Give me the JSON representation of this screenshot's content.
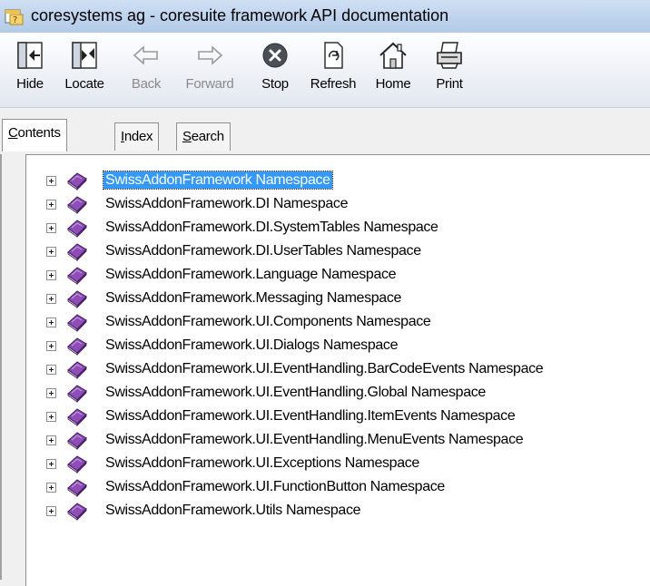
{
  "window": {
    "title": "coresystems ag - coresuite framework API documentation"
  },
  "toolbar": {
    "buttons": [
      {
        "label": "Hide",
        "icon": "hide-icon",
        "enabled": true
      },
      {
        "label": "Locate",
        "icon": "locate-icon",
        "enabled": true
      },
      {
        "label": "Back",
        "icon": "back-arrow-icon",
        "enabled": false
      },
      {
        "label": "Forward",
        "icon": "forward-arrow-icon",
        "enabled": false
      },
      {
        "label": "Stop",
        "icon": "stop-icon",
        "enabled": true
      },
      {
        "label": "Refresh",
        "icon": "refresh-icon",
        "enabled": true
      },
      {
        "label": "Home",
        "icon": "home-icon",
        "enabled": true
      },
      {
        "label": "Print",
        "icon": "print-icon",
        "enabled": true
      }
    ]
  },
  "tabs": [
    {
      "label": "Contents",
      "accesskey": "C",
      "rest": "ontents",
      "active": true
    },
    {
      "label": "Index",
      "accesskey": "I",
      "rest": "ndex",
      "active": false
    },
    {
      "label": "Search",
      "accesskey": "S",
      "rest": "earch",
      "active": false
    }
  ],
  "tree": {
    "items": [
      {
        "label": "SwissAddonFramework Namespace",
        "selected": true
      },
      {
        "label": "SwissAddonFramework.DI Namespace"
      },
      {
        "label": "SwissAddonFramework.DI.SystemTables Namespace"
      },
      {
        "label": "SwissAddonFramework.DI.UserTables Namespace"
      },
      {
        "label": "SwissAddonFramework.Language Namespace"
      },
      {
        "label": "SwissAddonFramework.Messaging Namespace"
      },
      {
        "label": "SwissAddonFramework.UI.Components Namespace"
      },
      {
        "label": "SwissAddonFramework.UI.Dialogs Namespace"
      },
      {
        "label": "SwissAddonFramework.UI.EventHandling.BarCodeEvents Namespace"
      },
      {
        "label": "SwissAddonFramework.UI.EventHandling.Global Namespace"
      },
      {
        "label": "SwissAddonFramework.UI.EventHandling.ItemEvents Namespace"
      },
      {
        "label": "SwissAddonFramework.UI.EventHandling.MenuEvents Namespace"
      },
      {
        "label": "SwissAddonFramework.UI.Exceptions Namespace"
      },
      {
        "label": "SwissAddonFramework.UI.FunctionButton Namespace"
      },
      {
        "label": "SwissAddonFramework.Utils Namespace"
      }
    ]
  },
  "colors": {
    "selection": "#3399ff",
    "book": "#7a3f9e",
    "title_bar": "#c4d7ef"
  }
}
